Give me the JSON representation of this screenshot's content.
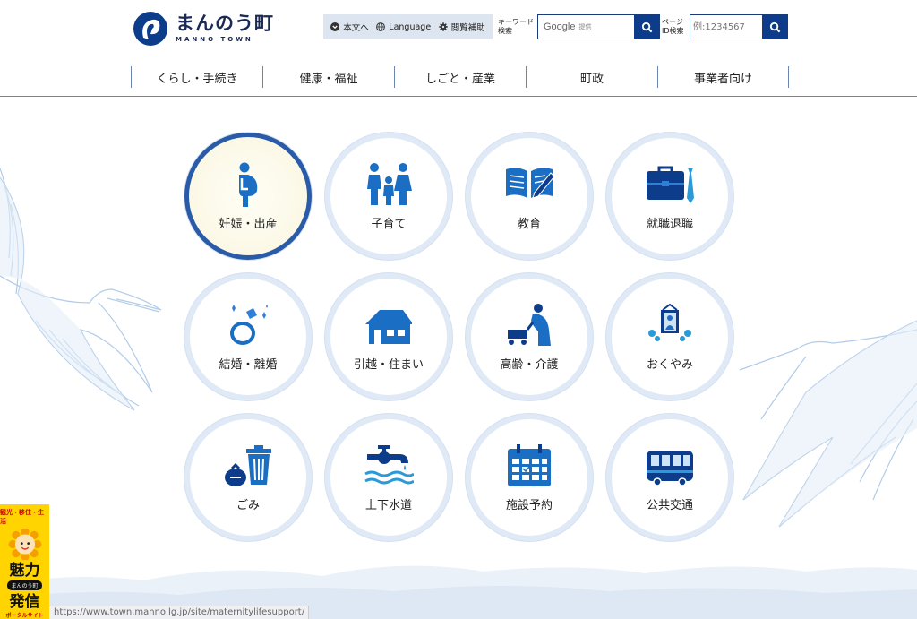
{
  "header": {
    "logo_name": "まんのう町",
    "logo_sub": "MANNO TOWN",
    "util_items": {
      "skip": "本文へ",
      "language": "Language",
      "accessibility": "閲覧補助"
    },
    "keyword_label_1": "キーワード",
    "keyword_label_2": "検索",
    "search_brand": "Google",
    "search_placeholder": "提供",
    "page_id_label_1": "ページ",
    "page_id_label_2": "ID検索",
    "page_id_placeholder": "例:1234567",
    "accent_color": "#0d3d8a"
  },
  "nav": [
    "くらし・手続き",
    "健康・福祉",
    "しごと・産業",
    "町政",
    "事業者向け"
  ],
  "categories": [
    {
      "label": "妊娠・出産",
      "icon": "pregnancy-icon",
      "active": true
    },
    {
      "label": "子育て",
      "icon": "family-icon"
    },
    {
      "label": "教育",
      "icon": "book-pen-icon"
    },
    {
      "label": "就職退職",
      "icon": "briefcase-tie-icon"
    },
    {
      "label": "結婚・離婚",
      "icon": "ring-icon"
    },
    {
      "label": "引越・住まい",
      "icon": "house-icon"
    },
    {
      "label": "高齢・介護",
      "icon": "elderly-care-icon"
    },
    {
      "label": "おくやみ",
      "icon": "memorial-portrait-icon"
    },
    {
      "label": "ごみ",
      "icon": "trash-bin-icon"
    },
    {
      "label": "上下水道",
      "icon": "water-tap-icon"
    },
    {
      "label": "施設予約",
      "icon": "calendar-icon"
    },
    {
      "label": "公共交通",
      "icon": "bus-icon"
    }
  ],
  "banner": {
    "line1": "観光・移住・生活",
    "line2": "魅力",
    "line3": "まんのう町",
    "line4": "発信",
    "line5": "ポータルサイト"
  },
  "status_url": "https://www.town.manno.lg.jp/site/maternitylifesupport/"
}
